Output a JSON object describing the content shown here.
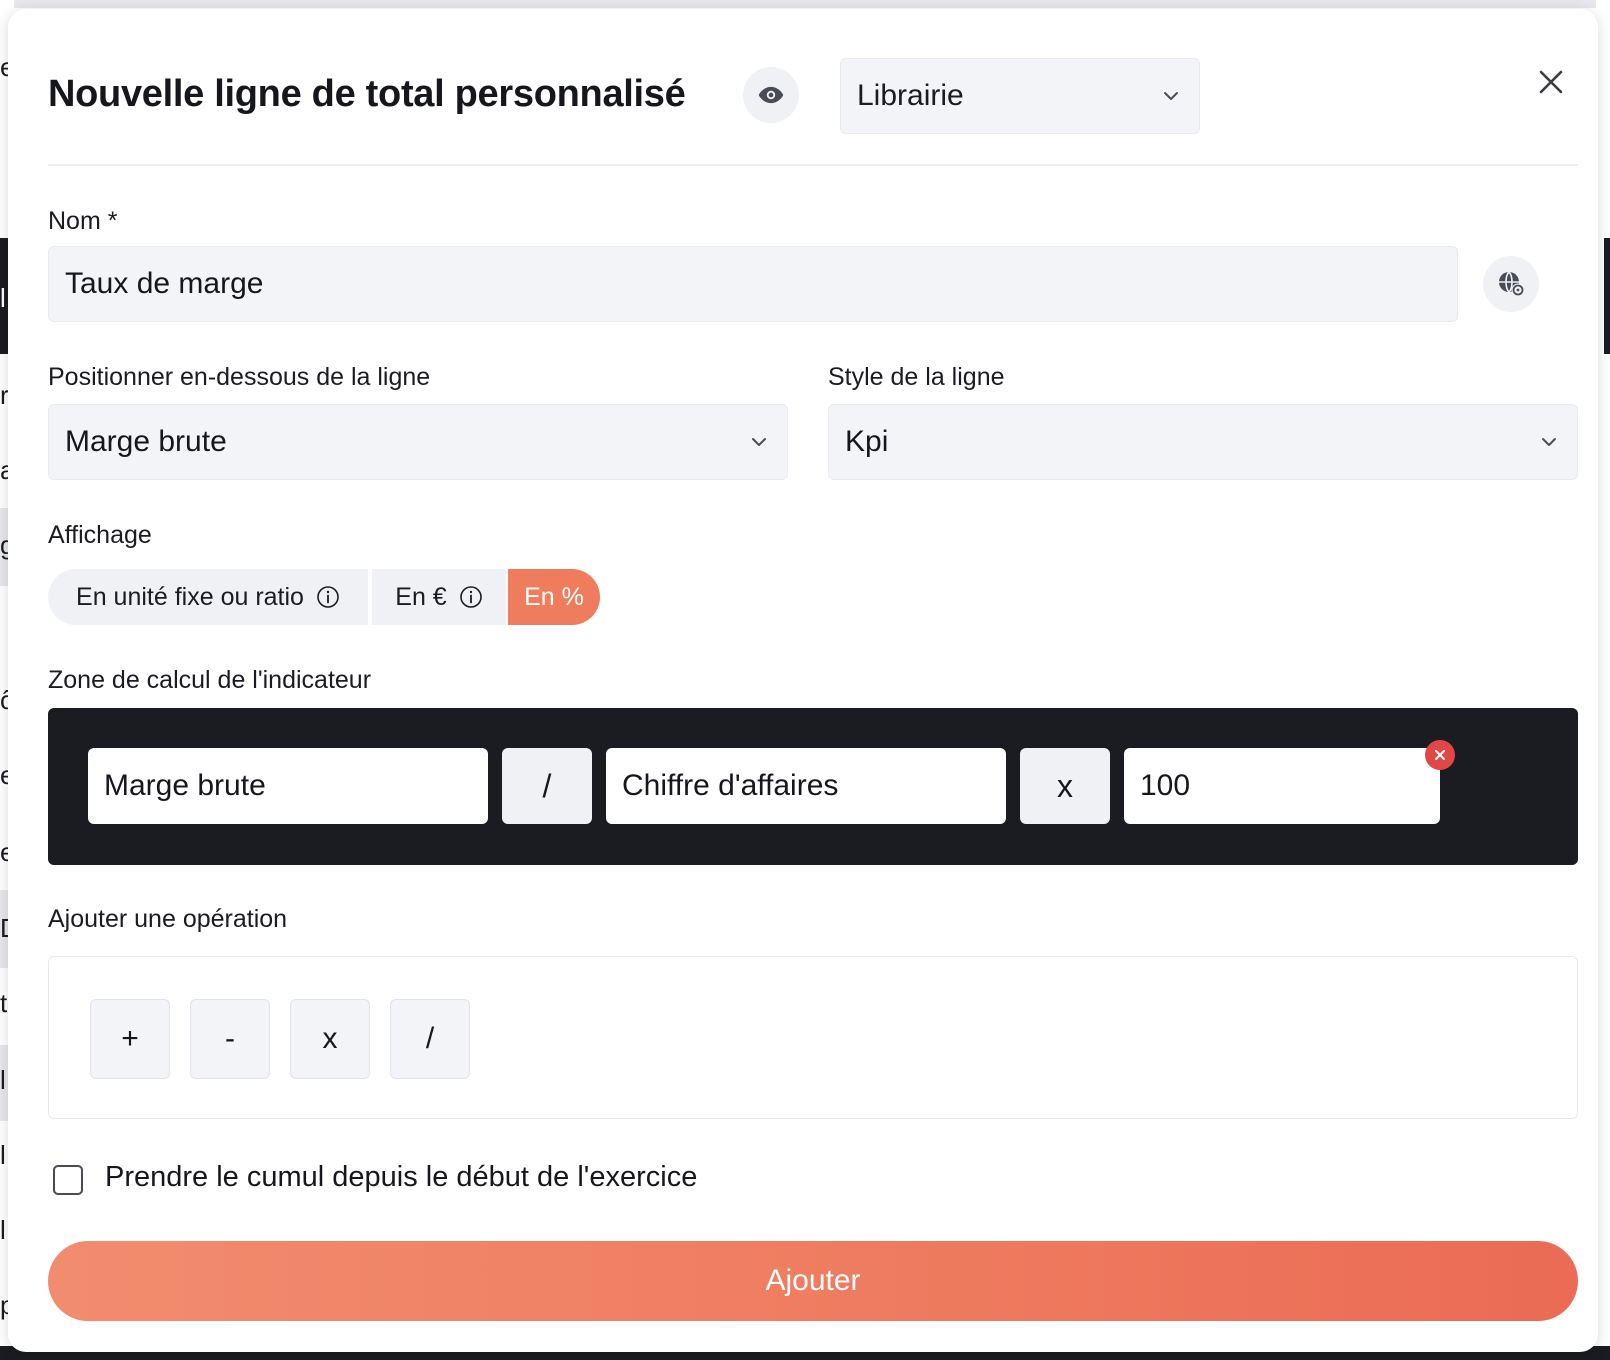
{
  "modal": {
    "title": "Nouvelle ligne de total personnalisé",
    "library_select": {
      "value": "Librairie"
    }
  },
  "form": {
    "name": {
      "label": "Nom *",
      "value": "Taux de marge"
    },
    "position": {
      "label": "Positionner en-dessous de la ligne",
      "value": "Marge brute"
    },
    "style": {
      "label": "Style de la ligne",
      "value": "Kpi"
    },
    "display": {
      "label": "Affichage",
      "options": [
        {
          "label": "En unité fixe ou ratio",
          "info": true,
          "active": false
        },
        {
          "label": "En €",
          "info": true,
          "active": false
        },
        {
          "label": "En %",
          "info": false,
          "active": true
        }
      ]
    },
    "calc_zone": {
      "label": "Zone de calcul de l'indicateur",
      "tokens": [
        "Marge brute",
        "/",
        "Chiffre d'affaires",
        "x",
        "100"
      ]
    },
    "add_operation": {
      "label": "Ajouter une opération",
      "operators": [
        "+",
        "-",
        "x",
        "/"
      ]
    },
    "cumulative_checkbox": {
      "label": "Prendre le cumul depuis le début de l'exercice",
      "checked": false
    },
    "submit_label": "Ajouter"
  },
  "background_letters": [
    "e",
    "l",
    "r",
    "a",
    "g",
    "ô",
    "e",
    "e",
    "D",
    "t",
    "l",
    "l",
    "l",
    "p"
  ],
  "colors": {
    "accent": "#ef7c5d",
    "dark_zone": "#1b1c22",
    "field_bg": "#f3f4f8",
    "danger": "#e04848"
  }
}
